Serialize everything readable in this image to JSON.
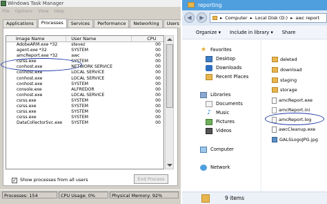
{
  "task_manager": {
    "title": "Windows Task Manager",
    "menu": [
      "File",
      "Options",
      "View",
      "Help"
    ],
    "tabs": [
      "Applications",
      "Processes",
      "Services",
      "Performance",
      "Networking",
      "Users"
    ],
    "active_tab": "Processes",
    "columns": {
      "image": "Image Name",
      "user": "User Name",
      "cpu": "CPU"
    },
    "processes": [
      {
        "image": "AdobeARM.exe *32",
        "user": "stevez",
        "cpu": "00"
      },
      {
        "image": "agent.exe *32",
        "user": "SYSTEM",
        "cpu": "00"
      },
      {
        "image": "amcReport.exe *32",
        "user": "awc",
        "cpu": "00"
      },
      {
        "image": "csrss.exe",
        "user": "SYSTEM",
        "cpu": "00"
      },
      {
        "image": "conhost.exe",
        "user": "NETWORK SERVICE",
        "cpu": "00"
      },
      {
        "image": "conhost.exe",
        "user": "LOCAL SERVICE",
        "cpu": "00"
      },
      {
        "image": "conhost.exe",
        "user": "LOCAL SERVICE",
        "cpu": "00"
      },
      {
        "image": "conhost.exe",
        "user": "SYSTEM",
        "cpu": "00"
      },
      {
        "image": "console.exe",
        "user": "ALFREDOR",
        "cpu": "00"
      },
      {
        "image": "conhost.exe",
        "user": "LOCAL SERVICE",
        "cpu": "00"
      },
      {
        "image": "csrss.exe",
        "user": "SYSTEM",
        "cpu": "00"
      },
      {
        "image": "csrss.exe",
        "user": "SYSTEM",
        "cpu": "00"
      },
      {
        "image": "csrss.exe",
        "user": "SYSTEM",
        "cpu": "00"
      },
      {
        "image": "csrss.exe",
        "user": "SYSTEM",
        "cpu": "00"
      },
      {
        "image": "DataCollectorSvc.exe",
        "user": "SYSTEM",
        "cpu": "00"
      }
    ],
    "show_all_checkbox": {
      "label": "Show processes from all users",
      "checked": true,
      "mark": "✓"
    },
    "end_process_label": "End Process",
    "status": {
      "processes": "Processes: 154",
      "cpu": "CPU Usage: 0%",
      "memory": "Physical Memory: 92%"
    }
  },
  "explorer": {
    "title": "reporting",
    "address": [
      "Computer",
      "Local Disk (D:)",
      "awc report"
    ],
    "address_sep": "▸",
    "toolbar": [
      "Organize ▾",
      "Include in library ▾",
      "Share"
    ],
    "nav": {
      "favorites": {
        "label": "Favorites",
        "items": [
          "Desktop",
          "Downloads",
          "Recent Places"
        ]
      },
      "libraries": {
        "label": "Libraries",
        "items": [
          "Documents",
          "Music",
          "Pictures",
          "Videos"
        ]
      },
      "computer": "Computer",
      "network": "Network"
    },
    "files": [
      {
        "name": "deleted",
        "icon": "folder-icon"
      },
      {
        "name": "download",
        "icon": "folder-icon"
      },
      {
        "name": "staging",
        "icon": "folder-icon"
      },
      {
        "name": "storage",
        "icon": "folder-icon"
      },
      {
        "name": "amcReport.exe",
        "icon": "exe-icon"
      },
      {
        "name": "amcReport.ini",
        "icon": "ini-icon"
      },
      {
        "name": "amcReport.log",
        "icon": "log-icon"
      },
      {
        "name": "awcCleanup.exe",
        "icon": "exe-icon"
      },
      {
        "name": "GALSLogoJPG.jpg",
        "icon": "image-icon"
      }
    ],
    "status": "9 items"
  },
  "annotation_color": "#1f3aa8"
}
